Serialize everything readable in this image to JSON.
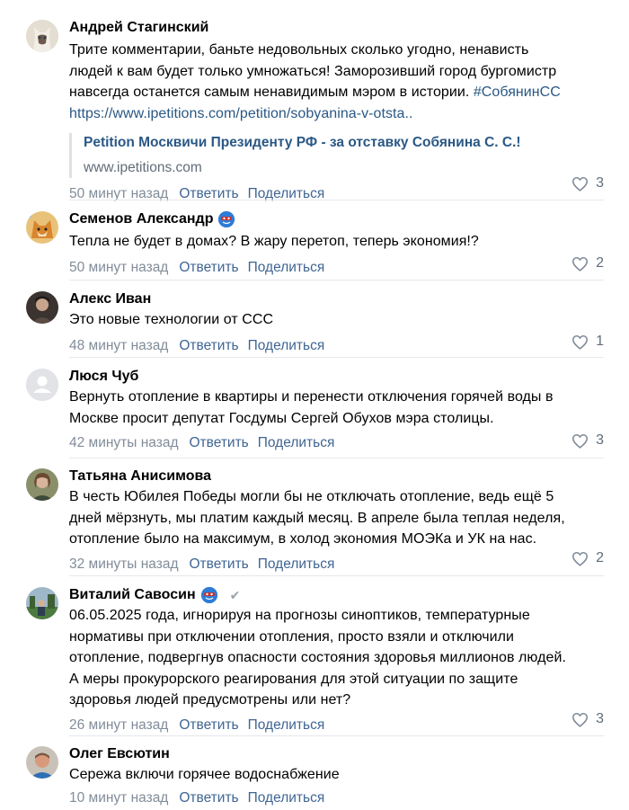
{
  "comments": [
    {
      "author": "Андрей Стагинский",
      "text_lines": [
        "Трите комментарии, баньте недовольных сколько угодно, ненависть",
        "людей к вам будет только умножаться! Заморозивший город бургомистр",
        "навсегда останется самым ненавидимым мэром в истории."
      ],
      "hashtag": "#СобянинСС",
      "link": "https://www.ipetitions.com/petition/sobyanina-v-otsta..",
      "snippet": {
        "title": "Petition Москвичи Президенту РФ - за отставку Собянина С. С.!",
        "domain": "www.ipetitions.com"
      },
      "time": "50 минут назад",
      "reply": "Ответить",
      "share": "Поделиться",
      "likes": "3"
    },
    {
      "author": "Семенов Александр",
      "text_lines": [
        "Тепла не будет в домах? В жару перетоп, теперь экономия!?"
      ],
      "time": "50 минут назад",
      "reply": "Ответить",
      "share": "Поделиться",
      "likes": "2"
    },
    {
      "author": "Алекс Иван",
      "text_lines": [
        "Это новые технологии от ССС"
      ],
      "time": "48 минут назад",
      "reply": "Ответить",
      "share": "Поделиться",
      "likes": "1"
    },
    {
      "author": "Люся Чуб",
      "text_lines": [
        "Вернуть отопление в квартиры и перенести отключения горячей воды в",
        "Москве просит депутат Госдумы Сергей Обухов мэра столицы."
      ],
      "time": "42 минуты назад",
      "reply": "Ответить",
      "share": "Поделиться",
      "likes": "3"
    },
    {
      "author": "Татьяна Анисимова",
      "text_lines": [
        "В честь Юбилея Победы могли бы не отключать отопление, ведь ещё 5",
        "дней мёрзнуть, мы платим каждый месяц. В апреле была теплая неделя,",
        "отопление было на максимум, в холод экономия МОЭКа и УК на нас."
      ],
      "time": "32 минуты назад",
      "reply": "Ответить",
      "share": "Поделиться",
      "likes": "2"
    },
    {
      "author": "Виталий Савосин",
      "text_lines": [
        "06.05.2025 года, игнорируя на прогнозы синоптиков, температурные",
        "нормативы при отключении отопления, просто взяли и отключили",
        "отопление, подвергнув опасности состояния здоровья миллионов людей.",
        "А меры прокурорского реагирования для этой ситуации по защите",
        "здоровья людей предусмотрены или нет?"
      ],
      "time": "26 минут назад",
      "reply": "Ответить",
      "share": "Поделиться",
      "likes": "3"
    },
    {
      "author": "Олег Евсютин",
      "text_lines": [
        "Сережа включи горячее водоснабжение"
      ],
      "time": "10 минут назад",
      "reply": "Ответить",
      "share": "Поделиться"
    }
  ],
  "colors": {
    "link": "#2a5885",
    "action": "#3f6593",
    "meta": "#818c99",
    "divider": "#e7e8ec"
  }
}
